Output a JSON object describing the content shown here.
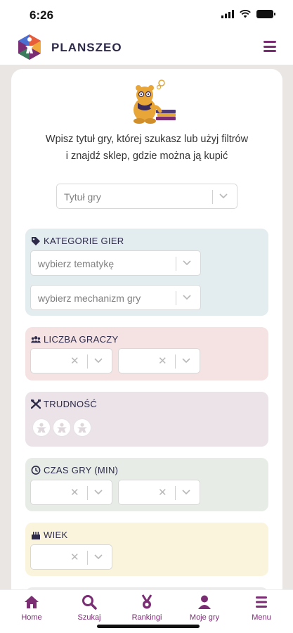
{
  "status_bar": {
    "time": "6:26"
  },
  "header": {
    "brand": "PLANSZEO"
  },
  "intro": {
    "line1": "Wpisz tytuł gry, której szukasz lub użyj filtrów",
    "line2": "i znajdź sklep, gdzie można ją kupić"
  },
  "search": {
    "title_placeholder": "Tytuł gry"
  },
  "categories": {
    "heading": "KATEGORIE GIER",
    "theme_placeholder": "wybierz tematykę",
    "mechanic_placeholder": "wybierz mechanizm gry"
  },
  "players": {
    "heading": "LICZBA GRACZY"
  },
  "difficulty": {
    "heading": "TRUDNOŚĆ",
    "level": 0,
    "max": 3
  },
  "time": {
    "heading": "CZAS GRY (MIN)"
  },
  "age": {
    "heading": "WIEK"
  },
  "tabbar": {
    "home": "Home",
    "search": "Szukaj",
    "rankings": "Rankingi",
    "my_games": "Moje gry",
    "menu": "Menu"
  },
  "colors": {
    "brand_purple": "#7a2d73",
    "categories_bg": "#e3ecef",
    "players_bg": "#f5e3e3",
    "difficulty_bg": "#ebe3e8",
    "time_bg": "#e7ece6",
    "age_bg": "#fbf4dd"
  }
}
